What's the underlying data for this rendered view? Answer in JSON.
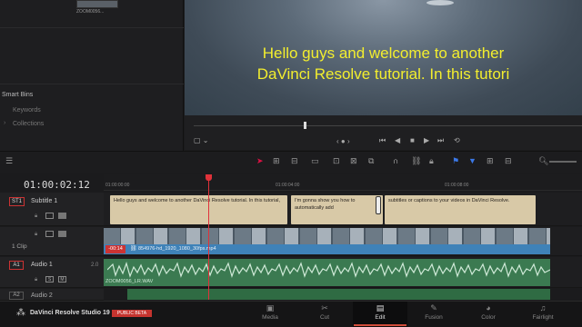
{
  "media_pool": {
    "clip_name": "ZOOM0056...",
    "smart_bins": {
      "title": "Smart Bins",
      "items": [
        "Keywords",
        "Collections"
      ]
    }
  },
  "viewer": {
    "subtitle_line1": "Hello guys and welcome to another",
    "subtitle_line2": "DaVinci Resolve tutorial. In this tutori"
  },
  "timeline": {
    "timecode": "01:00:02:12",
    "ruler_labels": [
      "01:00:00:00",
      "01:00:04:00",
      "01:00:08:00"
    ],
    "tracks": {
      "subtitle": {
        "tag": "ST1",
        "name": "Subtitle 1"
      },
      "video": {
        "name": "1 Clip"
      },
      "audio1": {
        "tag": "A1",
        "name": "Audio 1",
        "level": "2.0"
      },
      "audio2": {
        "tag": "A2",
        "name": "Audio 2"
      }
    },
    "subtitle_clips": [
      "Hello guys and welcome to another DaVinci Resolve tutorial. In this tutorial,",
      "I'm gonna show you how to automatically add",
      "subtitles or captions to your videos in DaVinci Resolve."
    ],
    "video_clip": {
      "badge": "-00:14",
      "name": "854976-hd_1920_1080_30fps.mp4"
    },
    "audio_clip": {
      "name": "ZOOM0056_LR.WAV"
    }
  },
  "footer": {
    "app_name": "DaVinci Resolve Studio 19",
    "beta_label": "PUBLIC BETA",
    "pages": [
      "Media",
      "Cut",
      "Edit",
      "Fusion",
      "Color",
      "Fairlight"
    ],
    "active_page": "Edit"
  },
  "colors": {
    "subtitle_text": "#f3ee2e",
    "playhead": "#e0323a",
    "video_clip": "#3f82b8",
    "audio_clip": "#3b7a51",
    "subtitle_clip": "#d8c9a7"
  }
}
